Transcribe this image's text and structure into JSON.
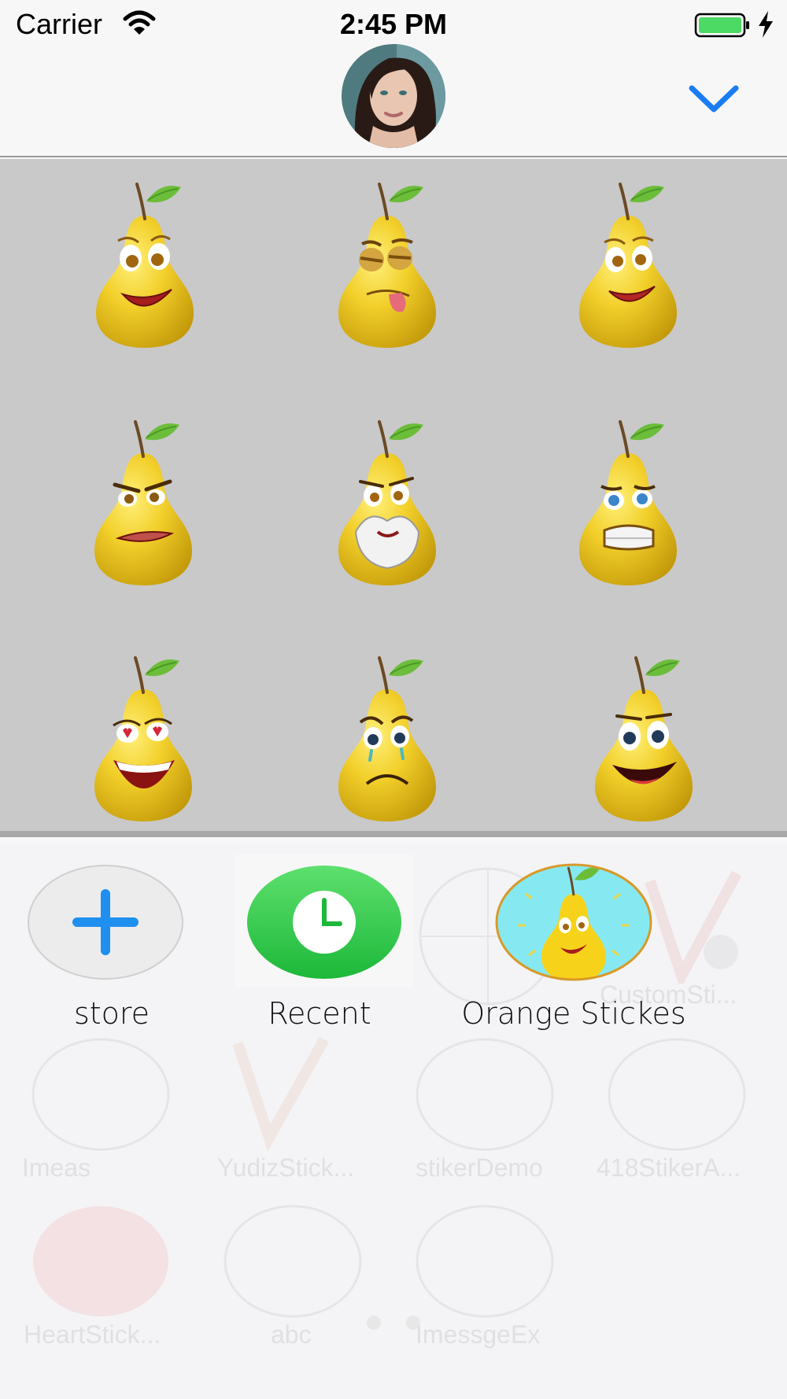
{
  "status_bar": {
    "carrier": "Carrier",
    "time": "2:45 PM"
  },
  "header": {
    "avatar_icon": "user-avatar-photo",
    "collapse_icon": "chevron-down-icon",
    "accent_color": "#1a7cf3"
  },
  "sticker_grid": {
    "background": "#c9c9c9",
    "stickers": [
      {
        "expression": "happy-surprised"
      },
      {
        "expression": "winking-tongue-out"
      },
      {
        "expression": "smiling"
      },
      {
        "expression": "angry-smirk"
      },
      {
        "expression": "bearded-old"
      },
      {
        "expression": "scared-grimace"
      },
      {
        "expression": "heart-eyes-laughing"
      },
      {
        "expression": "crying-sad"
      },
      {
        "expression": "big-grin"
      }
    ]
  },
  "drawer": {
    "apps": [
      {
        "label": "store",
        "icon": "plus-icon"
      },
      {
        "label": "Recent",
        "icon": "clock-icon"
      },
      {
        "label": "Orange Stickes",
        "icon": "pear-sticker-icon"
      }
    ],
    "faded_apps": [
      "CustomSti...",
      "Imeas",
      "YudizStick...",
      "stikerDemo",
      "418StikerA...",
      "HeartStick...",
      "abc",
      "ImessgeEx"
    ],
    "page_dots": 2
  }
}
